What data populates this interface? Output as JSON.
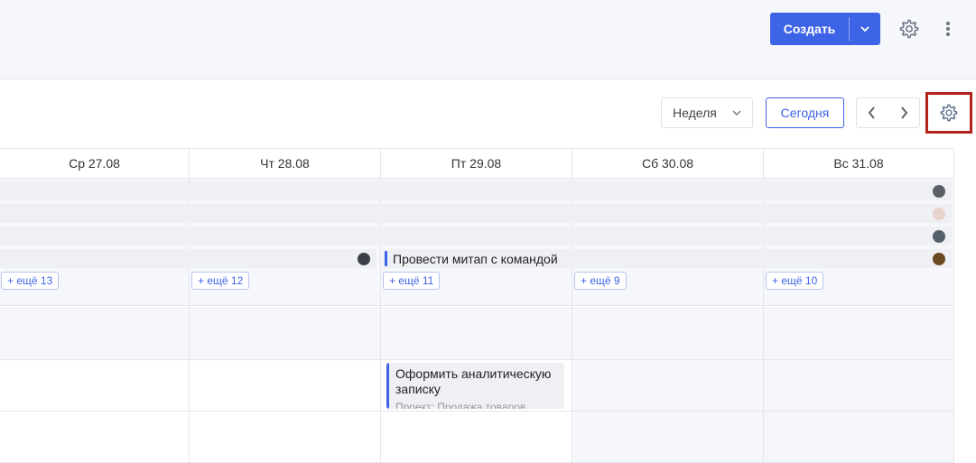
{
  "header": {
    "create_label": "Создать"
  },
  "toolbar": {
    "view_selected": "Неделя",
    "today_label": "Сегодня"
  },
  "days": [
    {
      "label": "Ср 27.08",
      "more": "+ ещё 13"
    },
    {
      "label": "Чт 28.08",
      "more": "+ ещё 12"
    },
    {
      "label": "Пт 29.08",
      "more": "+ ещё 11"
    },
    {
      "label": "Сб 30.08",
      "more": "+ ещё 9"
    },
    {
      "label": "Вс 31.08",
      "more": "+ ещё 10"
    }
  ],
  "events": {
    "allday_event": "Провести митап с командой",
    "timed_event_title": "Оформить аналитическую записку",
    "timed_event_subtitle": "Проект: Продажа товаров"
  },
  "colors": {
    "accent": "#3d63e6",
    "highlight_border": "#b2221c"
  }
}
